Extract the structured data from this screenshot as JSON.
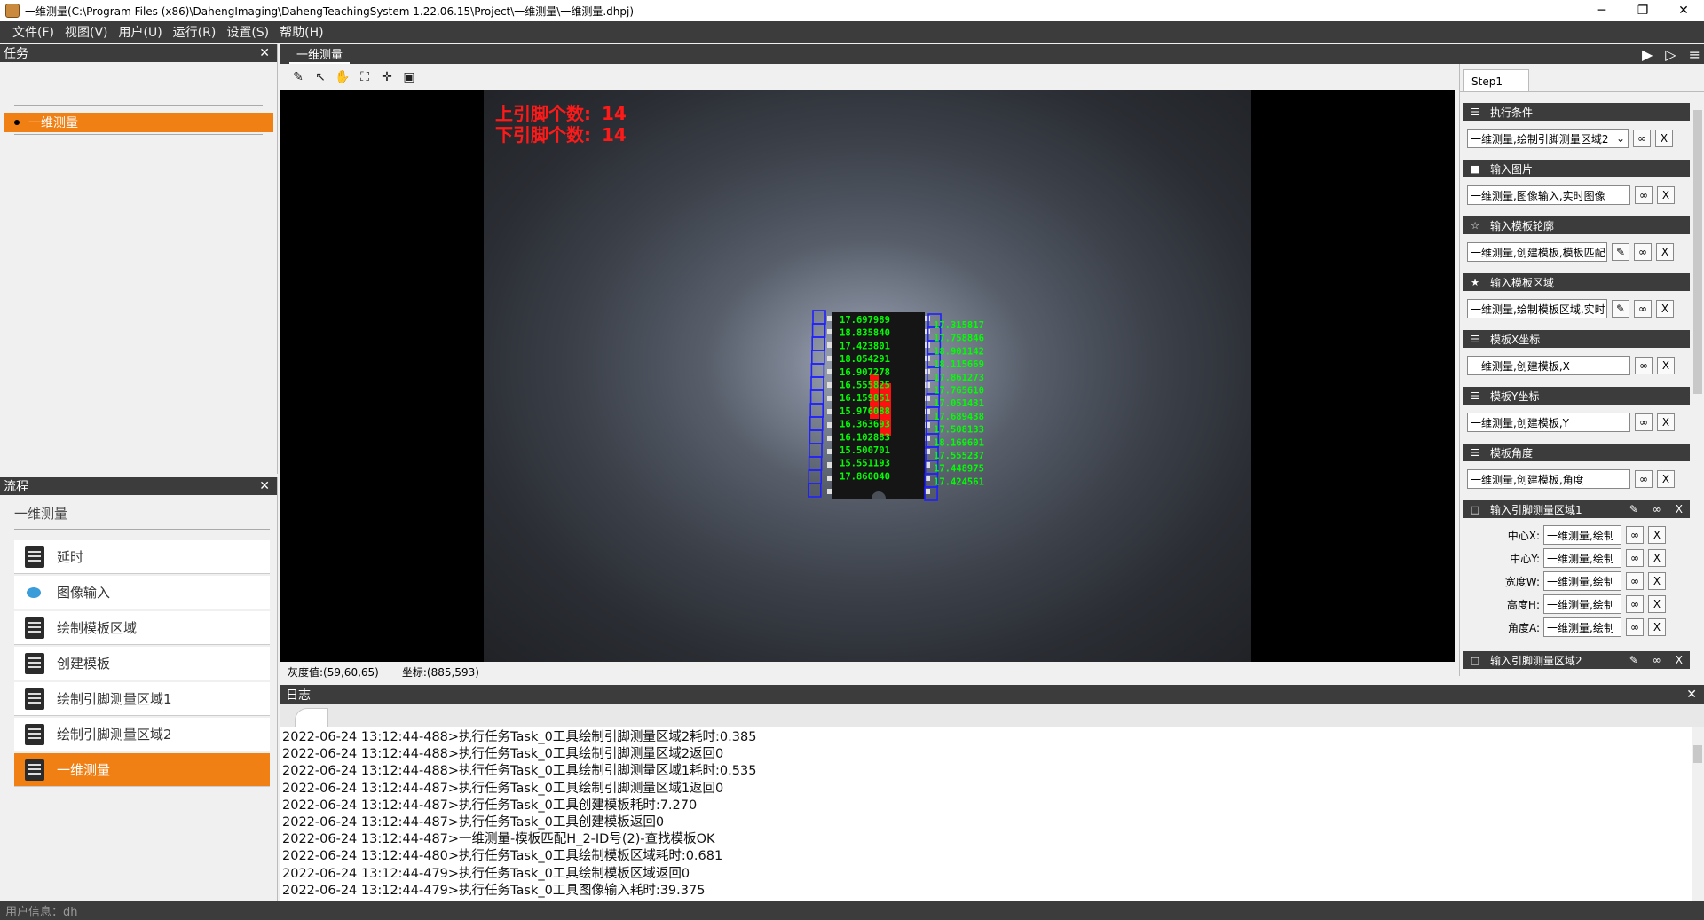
{
  "window": {
    "title": "一维测量(C:\\Program Files (x86)\\DahengImaging\\DahengTeachingSystem 1.22.06.15\\Project\\一维测量\\一维测量.dhpj)",
    "minimize": "─",
    "maximize": "❐",
    "close": "✕"
  },
  "menu": [
    "文件(F)",
    "视图(V)",
    "用户(U)",
    "运行(R)",
    "设置(S)",
    "帮助(H)"
  ],
  "task_panel": {
    "title": "任务",
    "close": "✕",
    "active_task": "一维测量"
  },
  "flow_panel": {
    "title": "流程",
    "close": "✕",
    "flow_name": "一维测量",
    "items": [
      "延时",
      "图像输入",
      "绘制模板区域",
      "创建模板",
      "绘制引脚测量区域1",
      "绘制引脚测量区域2",
      "一维测量"
    ],
    "active_index": 6
  },
  "image_view": {
    "tab": "一维测量",
    "upper_pin_label": "上引脚个数:",
    "upper_pin_count": "14",
    "lower_pin_label": "下引脚个数:",
    "lower_pin_count": "14",
    "left_pin_values": [
      "17.697989",
      "18.835840",
      "17.423801",
      "18.054291",
      "16.907278",
      "16.555825",
      "16.159851",
      "15.976088",
      "16.363693",
      "16.102883",
      "15.500701",
      "15.551193",
      "17.860040"
    ],
    "right_pin_values": [
      "17.315817",
      "17.758846",
      "18.901142",
      "18.115669",
      "17.861273",
      "17.765610",
      "17.051431",
      "17.689438",
      "17.508133",
      "18.169601",
      "17.555237",
      "17.448975",
      "17.424561"
    ],
    "gray_value": "灰度值:(59,60,65)",
    "coord": "坐标:(885,593)"
  },
  "log": {
    "title": "日志",
    "close": "✕",
    "lines": [
      "2022-06-24 13:12:44-488>执行任务Task_0工具绘制引脚测量区域2耗时:0.385",
      "2022-06-24 13:12:44-488>执行任务Task_0工具绘制引脚测量区域2返回0",
      "2022-06-24 13:12:44-488>执行任务Task_0工具绘制引脚测量区域1耗时:0.535",
      "2022-06-24 13:12:44-487>执行任务Task_0工具绘制引脚测量区域1返回0",
      "2022-06-24 13:12:44-487>执行任务Task_0工具创建模板耗时:7.270",
      "2022-06-24 13:12:44-487>执行任务Task_0工具创建模板返回0",
      "2022-06-24 13:12:44-487>一维测量-模板匹配H_2-ID号(2)-查找模板OK",
      "2022-06-24 13:12:44-480>执行任务Task_0工具绘制模板区域耗时:0.681",
      "2022-06-24 13:12:44-479>执行任务Task_0工具绘制模板区域返回0",
      "2022-06-24 13:12:44-479>执行任务Task_0工具图像输入耗时:39.375"
    ]
  },
  "params": {
    "step_tab": "Step1",
    "link_symbol": "∞",
    "remove_symbol": "X",
    "edit_symbol": "✎",
    "sections": [
      {
        "title": "执行条件",
        "icon": "☰",
        "value": "一维测量,绘制引脚测量区域2"
      },
      {
        "title": "输入图片",
        "icon": "■",
        "value": "一维测量,图像输入,实时图像"
      },
      {
        "title": "输入模板轮廓",
        "icon": "☆",
        "value": "一维测量,创建模板,模板匹配"
      },
      {
        "title": "输入模板区域",
        "icon": "★",
        "value": "一维测量,绘制模板区域,实时"
      },
      {
        "title": "模板X坐标",
        "icon": "☰",
        "value": "一维测量,创建模板,X"
      },
      {
        "title": "模板Y坐标",
        "icon": "☰",
        "value": "一维测量,创建模板,Y"
      },
      {
        "title": "模板角度",
        "icon": "☰",
        "value": "一维测量,创建模板,角度"
      }
    ],
    "region1": {
      "title": "输入引脚测量区域1",
      "icon": "□",
      "rows": [
        {
          "label": "中心X:",
          "value": "一维测量,绘制"
        },
        {
          "label": "中心Y:",
          "value": "一维测量,绘制"
        },
        {
          "label": "宽度W:",
          "value": "一维测量,绘制"
        },
        {
          "label": "高度H:",
          "value": "一维测量,绘制"
        },
        {
          "label": "角度A:",
          "value": "一维测量,绘制"
        }
      ]
    },
    "region2": {
      "title": "输入引脚测量区域2",
      "icon": "□"
    }
  },
  "status": {
    "user_info": "用户信息：dh"
  },
  "colors": {
    "accent": "#f07f14",
    "dark": "#3c3c3c",
    "overlay_red": "#ff1a1a",
    "pin_green": "#00ff00",
    "pin_blue": "#2020ff"
  }
}
